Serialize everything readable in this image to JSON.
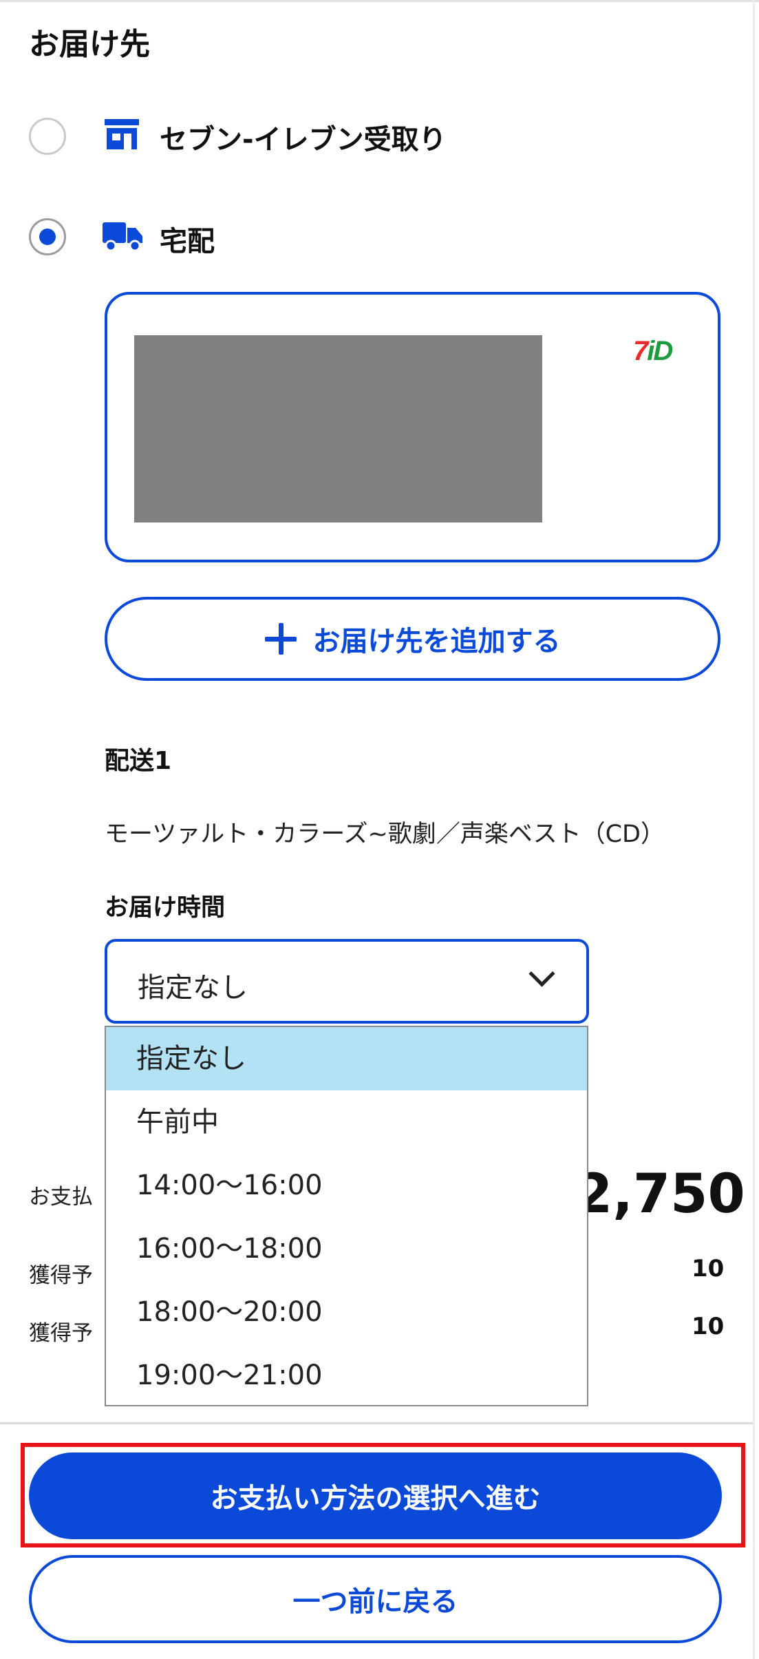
{
  "delivery": {
    "title": "お届け先",
    "options": [
      {
        "label": "セブン-イレブン受取り",
        "icon": "store-icon",
        "selected": false
      },
      {
        "label": "宅配",
        "icon": "truck-icon",
        "selected": true
      }
    ],
    "address_card": {
      "brand_logo": "7iD"
    },
    "add_address_label": "お届け先を追加する"
  },
  "shipment": {
    "title": "配送1",
    "product": "モーツァルト・カラーズ~歌劇／声楽ベスト（CD）",
    "time_label": "お届け時間",
    "time_select": {
      "value": "指定なし",
      "options": [
        "指定なし",
        "午前中",
        "14:00〜16:00",
        "16:00〜18:00",
        "18:00〜20:00",
        "19:00〜21:00"
      ],
      "highlighted_index": 0
    }
  },
  "summary": {
    "rows": [
      {
        "label": "お支払",
        "value": "2,750"
      },
      {
        "label": "獲得予",
        "value": "10"
      },
      {
        "label": "獲得予",
        "value": "10"
      }
    ]
  },
  "actions": {
    "primary_label": "お支払い方法の選択へ進む",
    "back_label": "一つ前に戻る"
  },
  "colors": {
    "accent": "#0b4ad8",
    "highlight_border": "#e8141b",
    "dropdown_selected": "#b3e2f5"
  }
}
